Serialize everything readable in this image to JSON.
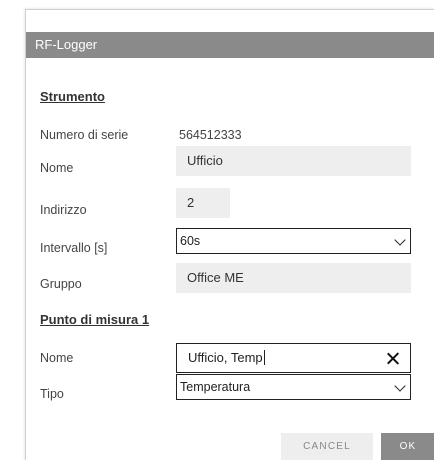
{
  "dialog": {
    "title": "RF-Logger"
  },
  "strumento": {
    "section_title": "Strumento",
    "serial_label": "Numero di serie",
    "serial_value": "564512333",
    "name_label": "Nome",
    "name_value": "Ufficio",
    "address_label": "Indirizzo",
    "address_value": "2",
    "interval_label": "Intervallo [s]",
    "interval_value": "60s",
    "group_label": "Gruppo",
    "group_value": "Office ME"
  },
  "punto": {
    "section_title": "Punto di misura 1",
    "name_label": "Nome",
    "name_value": "Ufficio, Temp",
    "type_label": "Tipo",
    "type_value": "Temperatura"
  },
  "buttons": {
    "cancel_label": "CANCEL",
    "ok_label": "OK"
  }
}
